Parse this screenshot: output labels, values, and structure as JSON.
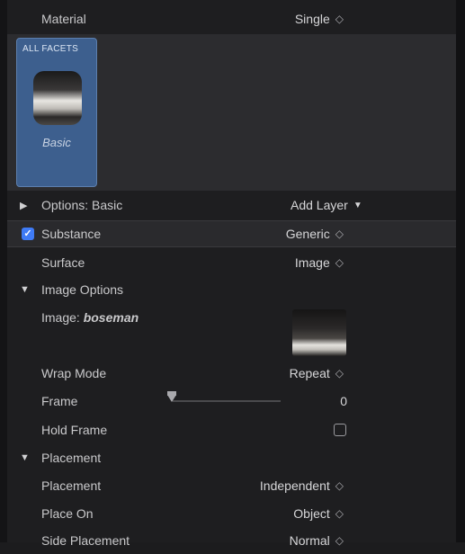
{
  "header": {
    "label": "Material",
    "value": "Single"
  },
  "facets": {
    "card_title": "ALL FACETS",
    "card_name": "Basic"
  },
  "options_row": {
    "label": "Options: Basic",
    "add_layer": "Add Layer"
  },
  "substance": {
    "label": "Substance",
    "value": "Generic",
    "checked": true
  },
  "surface": {
    "label": "Surface",
    "value": "Image"
  },
  "image_options": {
    "label": "Image Options"
  },
  "image": {
    "label_prefix": "Image: ",
    "label_name": "boseman"
  },
  "wrap_mode": {
    "label": "Wrap Mode",
    "value": "Repeat"
  },
  "frame": {
    "label": "Frame",
    "value": "0",
    "slider_fraction": 0.0
  },
  "hold_frame": {
    "label": "Hold Frame",
    "checked": false
  },
  "placement_section": {
    "label": "Placement"
  },
  "placement": {
    "label": "Placement",
    "value": "Independent"
  },
  "place_on": {
    "label": "Place On",
    "value": "Object"
  },
  "side_placement": {
    "label": "Side Placement",
    "value": "Normal"
  },
  "icons": {
    "updown": "⇳",
    "checkmark": "✓",
    "disclosure_right": "▶",
    "disclosure_down": "▼",
    "chevron_down": "⌄"
  },
  "colors": {
    "accent": "#3f7bf6",
    "facet_card": "#3d5f8e",
    "panel": "#1e1e20"
  }
}
